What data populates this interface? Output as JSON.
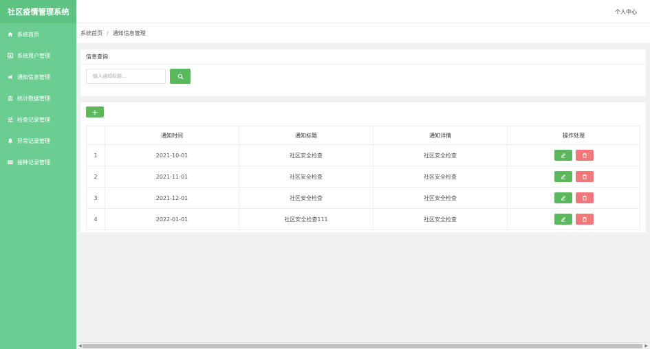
{
  "app": {
    "title": "社区疫情管理系统"
  },
  "header": {
    "user_center": "个人中心"
  },
  "sidebar": {
    "items": [
      {
        "label": "系统首页",
        "icon": "home-icon"
      },
      {
        "label": "系统用户管理",
        "icon": "address-card-icon"
      },
      {
        "label": "通知信息管理",
        "icon": "bullhorn-icon"
      },
      {
        "label": "统计数据管理",
        "icon": "bank-icon"
      },
      {
        "label": "检查记录管理",
        "icon": "sliders-icon"
      },
      {
        "label": "异常记录管理",
        "icon": "bell-icon"
      },
      {
        "label": "接种记录管理",
        "icon": "id-card-icon"
      }
    ]
  },
  "breadcrumb": {
    "home": "系统首页",
    "separator": "/",
    "current": "通知信息管理"
  },
  "query": {
    "title": "信息查询",
    "placeholder": "输入通知标题..."
  },
  "table": {
    "headers": [
      "",
      "通知时间",
      "通知标题",
      "通知详情",
      "操作处理"
    ],
    "rows": [
      {
        "idx": "1",
        "time": "2021-10-01",
        "title": "社区安全检查",
        "detail": "社区安全检查"
      },
      {
        "idx": "2",
        "time": "2021-11-01",
        "title": "社区安全检查",
        "detail": "社区安全检查"
      },
      {
        "idx": "3",
        "time": "2021-12-01",
        "title": "社区安全检查",
        "detail": "社区安全检查"
      },
      {
        "idx": "4",
        "time": "2022-01-01",
        "title": "社区安全检查111",
        "detail": "社区安全检查"
      }
    ]
  },
  "colors": {
    "sidebar": "#6bcd91",
    "brand": "#5dc282",
    "primary": "#5cb85c",
    "danger": "#f0787a"
  }
}
